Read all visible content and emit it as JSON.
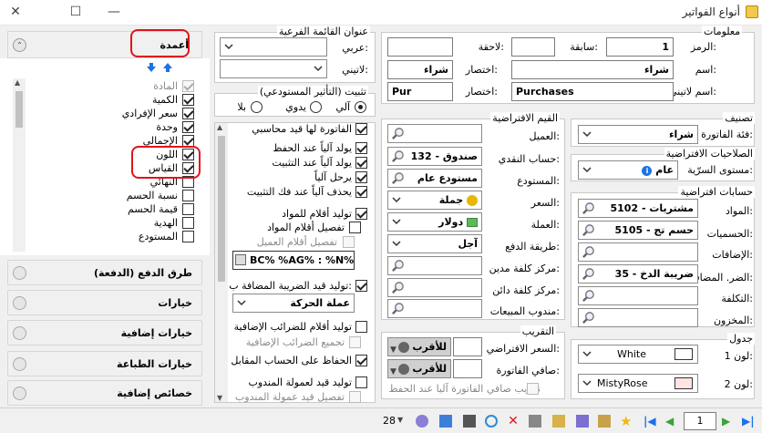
{
  "window": {
    "title": "أنواع الفواتير"
  },
  "info": {
    "title": "معلومات",
    "code_label": "الرمز:",
    "code_value": "1",
    "prev_label": "سابقة:",
    "prev_value": "",
    "next_label": "لاحقة:",
    "next_value": "",
    "name_label": "اسم:",
    "name_value": "شراء",
    "abbr_label": "اختصار:",
    "abbr_value": "شراء",
    "latin_name_label": "اسم لاتيني:",
    "latin_name_value": "Purchases",
    "latin_abbr_label": "اختصار:",
    "latin_abbr_value": "Pur"
  },
  "classification": {
    "title": "تصنيف",
    "category_label": "فئة الفاتورة:",
    "category_value": "شراء"
  },
  "permissions": {
    "title": "الصلاحيات الافتراضية",
    "secrecy_label": "مستوى السرّية:",
    "secrecy_value": "عام"
  },
  "default_accounts": {
    "title": "حسابات افتراضية",
    "materials_label": "المواد:",
    "materials_value": "5102 - مشتريات",
    "discounts_label": "الحسميات:",
    "discounts_value": "5105 - حسم تج",
    "additions_label": "الإضافات:",
    "additions_value": "",
    "vat_label": "الضر. المضافة:",
    "vat_value": "35 - ضريبة الدخ",
    "cost_label": "التكلفة:",
    "cost_value": "",
    "stock_label": "المخزون:",
    "stock_value": ""
  },
  "table": {
    "title": "جدول",
    "color1_label": "لون 1:",
    "color1_value": "White",
    "color1_hex": "#ffffff",
    "color2_label": "لون 2:",
    "color2_value": "MistyRose",
    "color2_hex": "#ffe4e1"
  },
  "default_values": {
    "title": "القيم الافتراضية",
    "customer_label": "العميل:",
    "customer_value": "",
    "cash_label": "حساب النقدي:",
    "cash_value": "132 - صندوق",
    "warehouse_label": "المستودع:",
    "warehouse_value": "مستودع عام",
    "price_label": "السعر:",
    "price_value": "جملة",
    "currency_label": "العملة:",
    "currency_value": "دولار",
    "payment_label": "طريقة الدفع:",
    "payment_value": "آجل",
    "cost_center_debit_label": "مركز كلفة مدين:",
    "cost_center_debit_value": "",
    "cost_center_credit_label": "مركز كلفة دائن:",
    "cost_center_credit_value": "",
    "sales_rep_label": "مندوب المبيعات:",
    "sales_rep_value": ""
  },
  "rounding": {
    "title": "التقريب",
    "default_price_label": "السعر الافتراضي:",
    "default_price_mode": "للأقرب",
    "net_invoice_label": "صافي الفاتورة:",
    "net_invoice_mode": "للأقرب",
    "auto_round_label": "تقريب صافي الفاتورة آليا عند الحفظ"
  },
  "submenu": {
    "title": "عنوان القائمة الفرعية",
    "arabic_label": "عربي:",
    "latin_label": "لاتيني:"
  },
  "installation": {
    "title": "تثبيت (التأثير المستودعي)",
    "options": [
      "آلي",
      "يدوي",
      "بلا"
    ]
  },
  "options_list": [
    {
      "label": "الفاتورة لها قيد محاسبي",
      "checked": true,
      "enabled": true
    },
    {
      "label": "يولد آلياً عند الحفظ",
      "checked": true,
      "enabled": true
    },
    {
      "label": "يولد آلياً عند التثبيت",
      "checked": true,
      "enabled": true
    },
    {
      "label": "يرحل آلياً",
      "checked": true,
      "enabled": true
    },
    {
      "label": "يحذف آلياً عند فك التثبيت",
      "checked": true,
      "enabled": true
    },
    {
      "label": "توليد أقلام للمواد",
      "checked": true,
      "enabled": true
    },
    {
      "label": "تفصيل أقلام المواد",
      "checked": false,
      "enabled": true
    },
    {
      "label": "تفصيل أقلام العميل",
      "checked": false,
      "enabled": false
    }
  ],
  "formula": {
    "value": "BC% %AG% : %N%"
  },
  "vat_entry": {
    "label": "توليد قيد الضريبة المضافة ب:",
    "checked": true,
    "value": "عملة الحركة"
  },
  "options_list2": [
    {
      "label": "توليد أقلام للضرائب الإضافية",
      "checked": false,
      "enabled": true
    },
    {
      "label": "تجميع الضرائب الإضافية",
      "checked": false,
      "enabled": false
    },
    {
      "label": "الحفاظ على الحساب المقابل",
      "checked": true,
      "enabled": true
    },
    {
      "label": "توليد قيد لعمولة المندوب",
      "checked": false,
      "enabled": true
    },
    {
      "label": "تفصيل قيد عمولة المندوب",
      "checked": false,
      "enabled": false
    }
  ],
  "columns": {
    "title": "أعمدة",
    "items": [
      {
        "label": "المادة",
        "checked": true,
        "enabled": false
      },
      {
        "label": "الكمية",
        "checked": true,
        "enabled": true
      },
      {
        "label": "سعر الإفرادي",
        "checked": true,
        "enabled": true
      },
      {
        "label": "وحدة",
        "checked": true,
        "enabled": true
      },
      {
        "label": "الإجمالي",
        "checked": true,
        "enabled": true
      },
      {
        "label": "اللون",
        "checked": true,
        "enabled": true
      },
      {
        "label": "القياس",
        "checked": true,
        "enabled": true
      },
      {
        "label": "النهائي",
        "checked": false,
        "enabled": true
      },
      {
        "label": "نسبة الحسم",
        "checked": false,
        "enabled": true
      },
      {
        "label": "قيمة الحسم",
        "checked": false,
        "enabled": true
      },
      {
        "label": "الهدية",
        "checked": false,
        "enabled": true
      },
      {
        "label": "المستودع",
        "checked": false,
        "enabled": true
      }
    ]
  },
  "sections": [
    "طرق الدفع (الدفعة)",
    "خيارات",
    "خيارات إضافية",
    "خيارات الطباعة",
    "خصائص إضافية"
  ],
  "bottom_bar": {
    "record_count": "28",
    "page": "1"
  },
  "colors": {
    "highlight": "#e0141b",
    "accent_blue": "#1a73e8"
  }
}
